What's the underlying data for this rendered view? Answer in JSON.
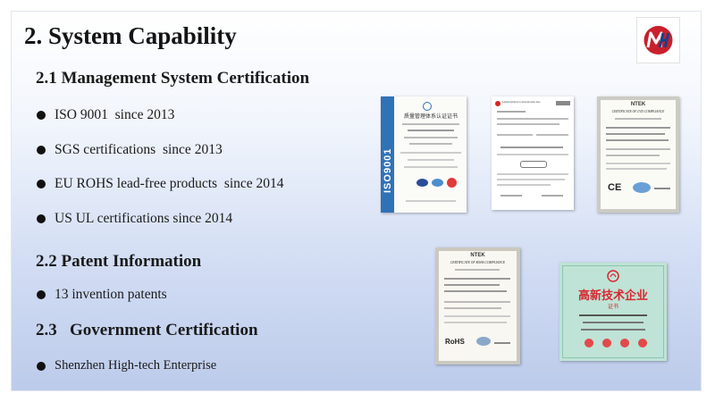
{
  "title": "2. System Capability",
  "sections": [
    {
      "heading": "2.1 Management System Certification",
      "items": [
        "ISO 9001  since 2013",
        "SGS certifications  since 2013",
        "EU ROHS lead-free products  since 2014",
        "US UL certifications since 2014"
      ]
    },
    {
      "heading": "2.2 Patent Information",
      "items": [
        "13 invention patents"
      ]
    },
    {
      "heading": "2.3   Government Certification",
      "items": [
        "Shenzhen High-tech Enterprise"
      ]
    }
  ],
  "certificates": {
    "iso": {
      "vertical_mark": "ISO9001",
      "header": "质量管理体系认证证书"
    },
    "ul": {
      "brand": "Underwriters Laboratories Inc."
    },
    "lvd": {
      "brand": "NTEK",
      "header": "CERTIFICATE OF LVD COMPLIANCE",
      "mark": "CE"
    },
    "rohs": {
      "brand": "NTEK",
      "header": "CERTIFICATE OF ROHS COMPLIANCE",
      "mark": "RoHS"
    },
    "hightech": {
      "header": "高新技术企业",
      "subheader": "证书"
    }
  },
  "colors": {
    "text": "#1a1a1a",
    "iso_blue": "#2f72b6",
    "hightech_red": "#d8262f",
    "hightech_bg": "#bfe3d6",
    "logo_red": "#c8202c",
    "logo_blue": "#1c3f8a"
  }
}
